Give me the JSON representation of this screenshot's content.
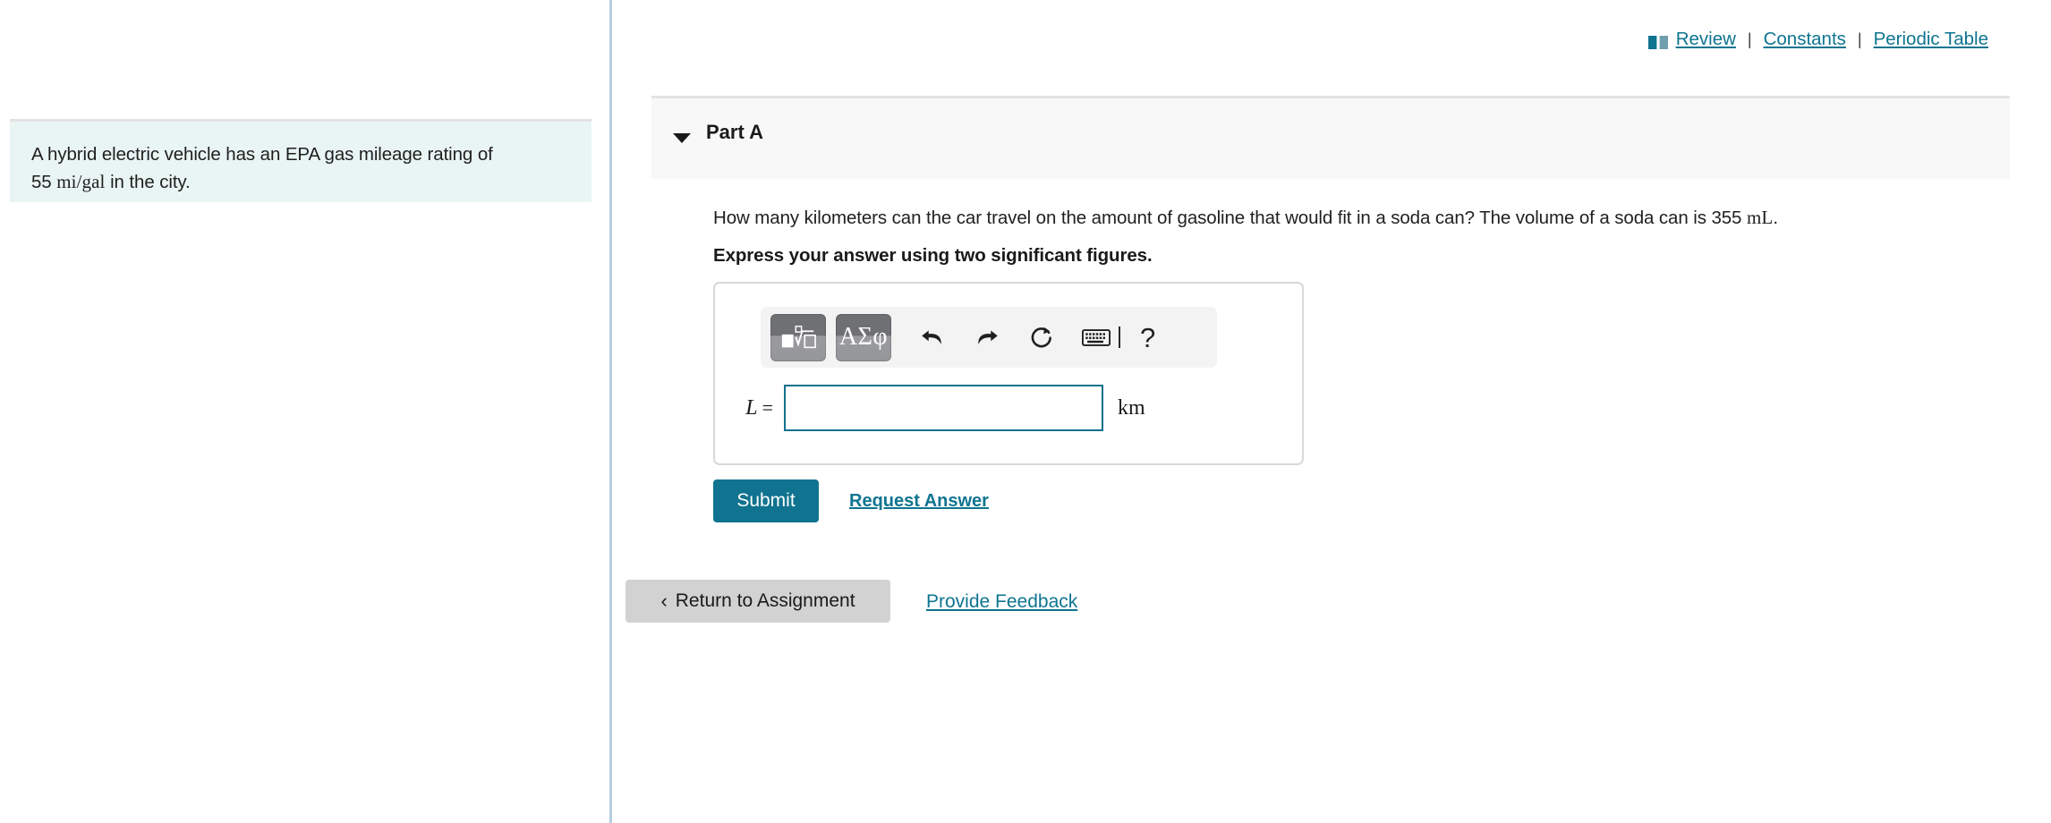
{
  "header": {
    "book_icon": "open-book-icon",
    "review_label": "Review",
    "separator": "|",
    "constants_label": "Constants",
    "periodic_table_label": "Periodic Table"
  },
  "left_panel": {
    "problem_line1": "A hybrid electric vehicle has an EPA gas mileage rating of",
    "problem_value": "55",
    "problem_units": "mi/gal",
    "problem_line2_tail": " in the city."
  },
  "part": {
    "caret_icon": "caret-down-icon",
    "title": "Part A",
    "question": "How many kilometers can the car travel on the amount of gasoline that would fit in a soda can? The volume of a soda can is 355 mL.",
    "question_prefix": "How many kilometers can the car travel on the amount of gasoline that would fit in a soda can? The volume of a soda can is 355 ",
    "question_unit": "mL",
    "question_suffix": ".",
    "instruction": "Express your answer using two significant figures."
  },
  "math_toolbar": {
    "template_button": "math-template-button",
    "greek_button_label": "ΑΣφ",
    "undo_icon": "undo-arrow-icon",
    "redo_icon": "redo-arrow-icon",
    "reset_icon": "reset-refresh-icon",
    "keyboard_icon": "keyboard-icon",
    "help_label": "?"
  },
  "answer": {
    "variable": "L",
    "equals": "=",
    "value": "",
    "placeholder": "",
    "unit": "km",
    "input_border_color": "#12718c"
  },
  "actions": {
    "submit_label": "Submit",
    "request_answer_label": "Request Answer",
    "return_chevron": "‹",
    "return_label": "Return to Assignment",
    "provide_feedback_label": "Provide Feedback"
  },
  "colors": {
    "accent_teal": "#0e7490",
    "submit_teal": "#10738f",
    "problem_box_bg": "#e9f5f3",
    "panel_divider": "#b6cde0",
    "part_band_bg": "#f8f8f8",
    "return_btn_bg": "#d2d2d2"
  }
}
